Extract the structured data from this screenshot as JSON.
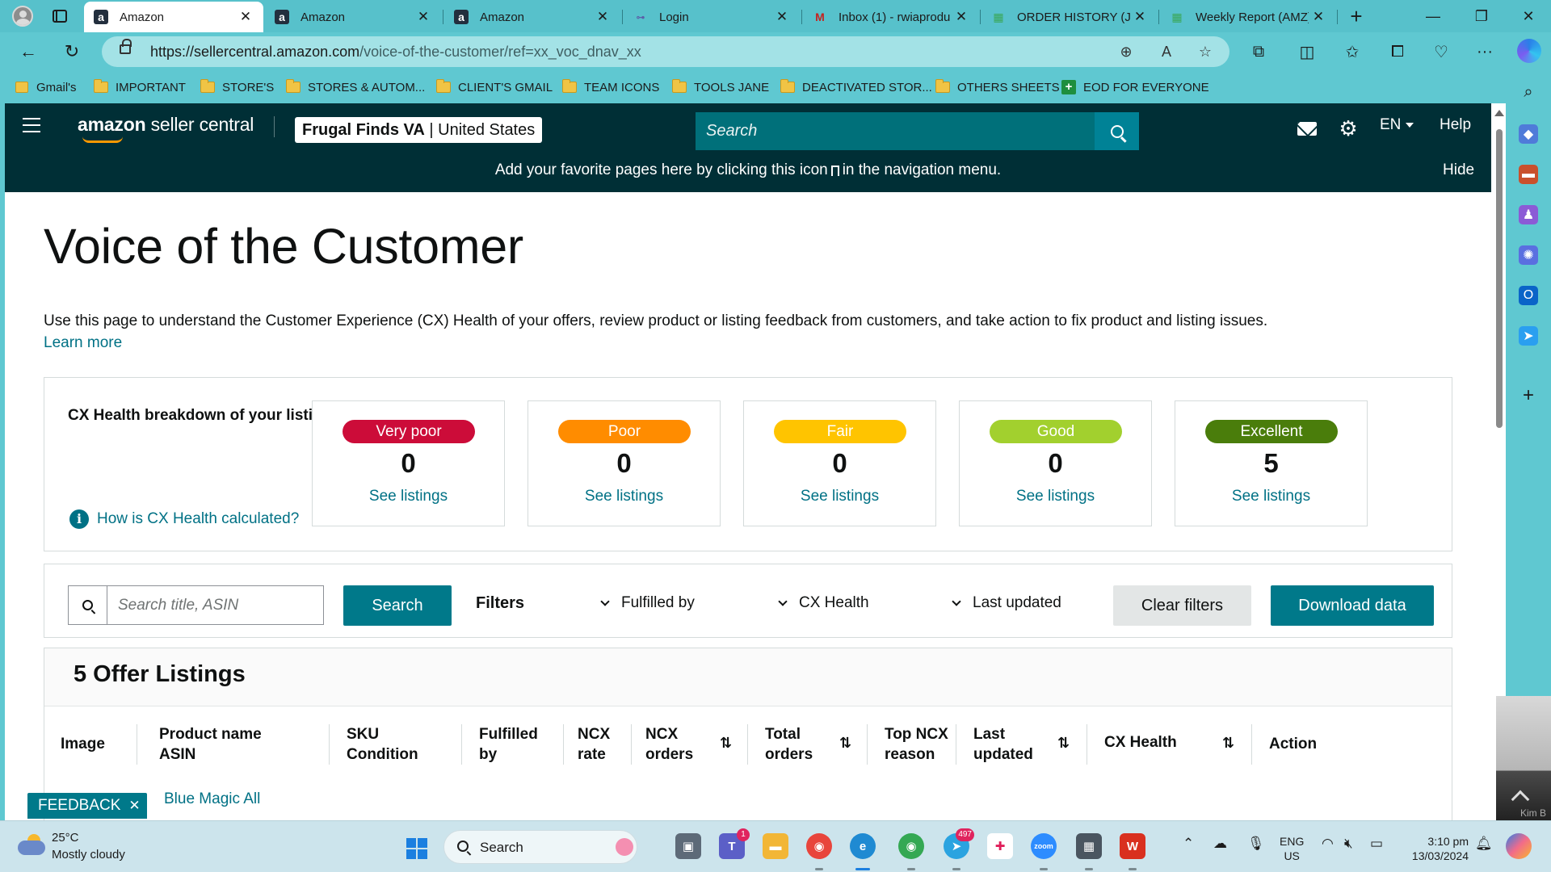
{
  "browser": {
    "tabs": [
      {
        "label": "Amazon",
        "favicon": "amazon-logo-icon",
        "active": true
      },
      {
        "label": "Amazon",
        "favicon": "amazon-logo-icon",
        "active": false
      },
      {
        "label": "Amazon",
        "favicon": "amazon-logo-icon",
        "active": false
      },
      {
        "label": "Login",
        "favicon": "login-site-icon",
        "active": false
      },
      {
        "label": "Inbox (1) - rwiaprodu",
        "favicon": "gmail-icon",
        "active": false
      },
      {
        "label": "ORDER HISTORY (JOS",
        "favicon": "sheets-icon",
        "active": false
      },
      {
        "label": "Weekly Report (AMZ)",
        "favicon": "sheets-icon",
        "active": false
      }
    ],
    "url_host": "https://sellercentral.amazon.com",
    "url_path": "/voice-of-the-customer/ref=xx_voc_dnav_xx",
    "bookmarks": [
      {
        "label": "Gmail's",
        "icon": "folder-icon"
      },
      {
        "label": "IMPORTANT",
        "icon": "folder-icon"
      },
      {
        "label": "STORE'S",
        "icon": "folder-icon"
      },
      {
        "label": "STORES & AUTOM...",
        "icon": "folder-icon"
      },
      {
        "label": "CLIENT'S GMAIL",
        "icon": "folder-icon"
      },
      {
        "label": "TEAM ICONS",
        "icon": "folder-icon"
      },
      {
        "label": "TOOLS JANE",
        "icon": "folder-icon"
      },
      {
        "label": "DEACTIVATED STOR...",
        "icon": "folder-icon"
      },
      {
        "label": "OTHERS SHEETS",
        "icon": "folder-icon"
      },
      {
        "label": "EOD FOR EVERYONE",
        "icon": "sheets-plus-icon"
      }
    ]
  },
  "seller_header": {
    "logo_amazon": "amazon",
    "logo_rest": " seller central",
    "merchant_name": "Frugal Finds VA",
    "marketplace": "United States",
    "search_placeholder": "Search",
    "language": "EN",
    "help": "Help"
  },
  "favorites_banner": {
    "text_before": "Add your favorite pages here by clicking this icon",
    "text_after": "in the navigation menu.",
    "hide": "Hide"
  },
  "page": {
    "title": "Voice of the Customer",
    "description": "Use this page to understand the Customer Experience (CX) Health of your offers, review product or listing feedback from customers, and take action to fix product and listing issues.",
    "learn_more": "Learn more"
  },
  "cx_health": {
    "title": "CX Health breakdown of your listings",
    "how_link": "How is CX Health calculated?",
    "cards": [
      {
        "label": "Very poor",
        "count": "0",
        "link": "See listings",
        "color": "#cc0c39"
      },
      {
        "label": "Poor",
        "count": "0",
        "link": "See listings",
        "color": "#ff8c00"
      },
      {
        "label": "Fair",
        "count": "0",
        "link": "See listings",
        "color": "#ffc400"
      },
      {
        "label": "Good",
        "count": "0",
        "link": "See listings",
        "color": "#a2d02e"
      },
      {
        "label": "Excellent",
        "count": "5",
        "link": "See listings",
        "color": "#4a7d0b"
      }
    ]
  },
  "filters": {
    "search_placeholder": "Search title, ASIN",
    "search_button": "Search",
    "filters_label": "Filters",
    "dropdowns": [
      "Fulfilled by",
      "CX Health",
      "Last updated"
    ],
    "clear_button": "Clear filters",
    "download_button": "Download data"
  },
  "listings": {
    "title": "5 Offer Listings",
    "columns": [
      {
        "line1": "Image",
        "line2": ""
      },
      {
        "line1": "Product name",
        "line2": "ASIN"
      },
      {
        "line1": "SKU",
        "line2": "Condition"
      },
      {
        "line1": "Fulfilled",
        "line2": "by"
      },
      {
        "line1": "NCX",
        "line2": "rate"
      },
      {
        "line1": "NCX",
        "line2": "orders"
      },
      {
        "line1": "Total",
        "line2": "orders"
      },
      {
        "line1": "Top NCX",
        "line2": "reason"
      },
      {
        "line1": "Last",
        "line2": "updated"
      },
      {
        "line1": "CX Health",
        "line2": ""
      },
      {
        "line1": "Action",
        "line2": ""
      }
    ],
    "first_row_peek": "Blue Magic All"
  },
  "feedback_tab": "FEEDBACK",
  "video_thumb_name": "Kim B",
  "taskbar": {
    "weather_temp": "25°C",
    "weather_desc": "Mostly cloudy",
    "search_label": "Search",
    "teams_badge": "1",
    "telegram_badge": "497",
    "lang_line1": "ENG",
    "lang_line2": "US",
    "time": "3:10 pm",
    "date": "13/03/2024"
  }
}
